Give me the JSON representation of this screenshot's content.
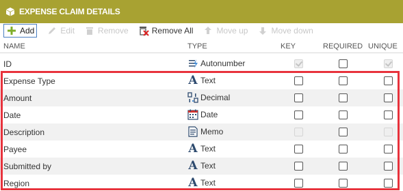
{
  "header": {
    "title": "EXPENSE CLAIM DETAILS",
    "icon": "cube-icon"
  },
  "toolbar": {
    "add_label": "Add",
    "edit_label": "Edit",
    "remove_label": "Remove",
    "remove_all_label": "Remove All",
    "move_up_label": "Move up",
    "move_down_label": "Move down"
  },
  "columns": {
    "name": "NAME",
    "type": "TYPE",
    "key": "KEY",
    "required": "REQUIRED",
    "unique": "UNIQUE"
  },
  "rows": [
    {
      "name": "ID",
      "type": "Autonumber",
      "icon": "autonumber-icon",
      "key": "checked-disabled",
      "required": "unchecked",
      "unique": "checked-disabled"
    },
    {
      "name": "Expense Type",
      "type": "Text",
      "icon": "text-icon",
      "key": "unchecked",
      "required": "unchecked",
      "unique": "unchecked"
    },
    {
      "name": "Amount",
      "type": "Decimal",
      "icon": "decimal-icon",
      "key": "unchecked",
      "required": "unchecked",
      "unique": "unchecked"
    },
    {
      "name": "Date",
      "type": "Date",
      "icon": "calendar-icon",
      "key": "unchecked",
      "required": "unchecked",
      "unique": "unchecked"
    },
    {
      "name": "Description",
      "type": "Memo",
      "icon": "memo-icon",
      "key": "disabled",
      "required": "unchecked",
      "unique": "disabled"
    },
    {
      "name": "Payee",
      "type": "Text",
      "icon": "text-icon",
      "key": "unchecked",
      "required": "unchecked",
      "unique": "unchecked"
    },
    {
      "name": "Submitted by",
      "type": "Text",
      "icon": "text-icon",
      "key": "unchecked",
      "required": "unchecked",
      "unique": "unchecked"
    },
    {
      "name": "Region",
      "type": "Text",
      "icon": "text-icon",
      "key": "unchecked",
      "required": "unchecked",
      "unique": "unchecked"
    }
  ],
  "colors": {
    "header_bg": "#a8a232",
    "highlight": "#e8323c",
    "add_border": "#4a7fc2"
  }
}
